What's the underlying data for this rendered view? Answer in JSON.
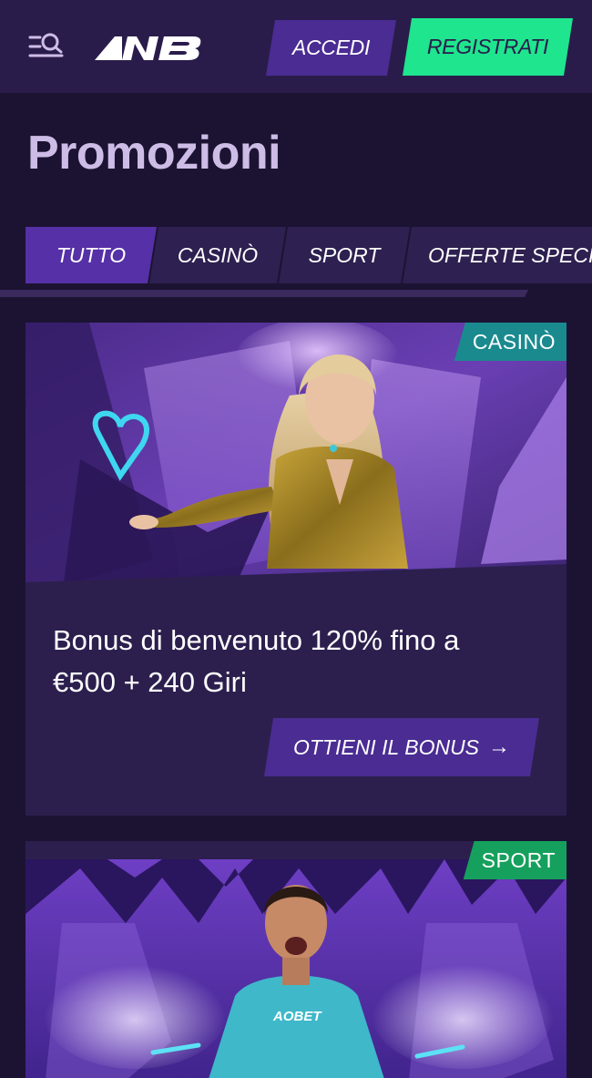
{
  "header": {
    "logo_alt": "XB",
    "login_label": "ACCEDI",
    "register_label": "REGISTRATI",
    "accent_green": "#1ee58e",
    "accent_purple": "#4a2c93"
  },
  "page": {
    "title": "Promozioni"
  },
  "tabs": [
    {
      "label": "TUTTO",
      "active": true
    },
    {
      "label": "CASINÒ",
      "active": false
    },
    {
      "label": "SPORT",
      "active": false
    },
    {
      "label": "OFFERTE SPECIA",
      "active": false
    }
  ],
  "promos": [
    {
      "category": "CASINÒ",
      "title": "Bonus di benvenuto 120% fino a €500 + 240 Giri",
      "cta_label": "OTTIENI IL BONUS",
      "badge_color": "#1a8a8f"
    },
    {
      "category": "SPORT",
      "shirt_text": "AOBET",
      "badge_color": "#16a05d"
    }
  ],
  "icons": {
    "menu": "menu-search-icon",
    "cta_arrow": "arrow-right-icon"
  }
}
